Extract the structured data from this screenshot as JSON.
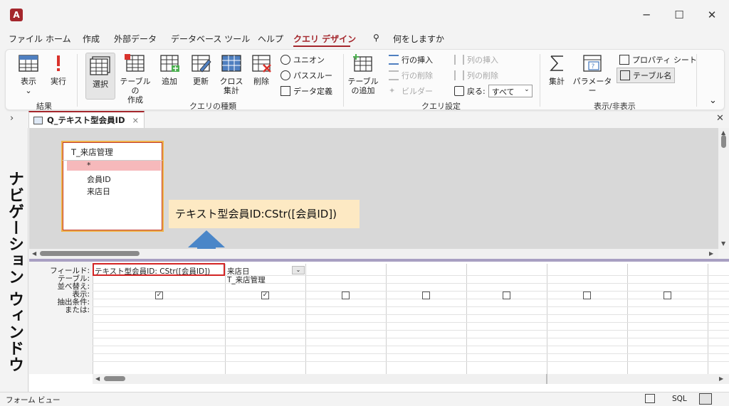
{
  "window": {
    "app_icon": "A",
    "controls": {
      "minimize": "─",
      "maximize": "☐",
      "close": "✕"
    }
  },
  "menu": {
    "tabs": [
      "ファイル",
      "ホーム",
      "作成",
      "外部データ",
      "データベース ツール",
      "ヘルプ",
      "クエリ デザイン"
    ],
    "search_placeholder": "何をしますか"
  },
  "ribbon": {
    "results_group": {
      "label": "結果",
      "view": "表示",
      "run": "実行"
    },
    "query_type_group": {
      "label": "クエリの種類",
      "select": "選択",
      "make_table": "テーブルの\n作成",
      "append": "追加",
      "update": "更新",
      "crosstab": "クロス\n集計",
      "delete": "削除",
      "union": "ユニオン",
      "pass_through": "パススルー",
      "data_definition": "データ定義"
    },
    "query_setup_group": {
      "label": "クエリ設定",
      "add_table": "テーブル\nの追加",
      "insert_rows": "行の挿入",
      "delete_rows": "行の削除",
      "builder": "ビルダー",
      "insert_cols": "列の挿入",
      "delete_cols": "列の削除",
      "return_label": "戻る:",
      "return_value": "すべて"
    },
    "show_hide_group": {
      "label": "表示/非表示",
      "totals": "集計",
      "parameters": "パラメーター",
      "property_sheet": "プロパティ シート",
      "table_names": "テーブル名"
    }
  },
  "document_tab": {
    "title": "Q_テキスト型会員ID"
  },
  "nav_pane": {
    "label": "ナビゲーション ウィンドウ"
  },
  "table_box": {
    "title": "T_来店管理",
    "fields": [
      "*",
      "会員ID",
      "来店日"
    ]
  },
  "callout": {
    "text": "テキスト型会員ID:CStr([会員ID])"
  },
  "grid": {
    "row_labels": [
      "フィールド:",
      "テーブル:",
      "並べ替え:",
      "表示:",
      "抽出条件:",
      "または:"
    ],
    "columns": [
      {
        "field": "テキスト型会員ID: CStr([会員ID])",
        "table": "",
        "show": true
      },
      {
        "field": "来店日",
        "table": "T_来店管理",
        "show": true
      },
      {
        "field": "",
        "table": "",
        "show": false
      },
      {
        "field": "",
        "table": "",
        "show": false
      },
      {
        "field": "",
        "table": "",
        "show": false
      },
      {
        "field": "",
        "table": "",
        "show": false
      },
      {
        "field": "",
        "table": "",
        "show": false
      }
    ]
  },
  "status": {
    "left": "フォーム ビュー",
    "sql": "SQL"
  }
}
